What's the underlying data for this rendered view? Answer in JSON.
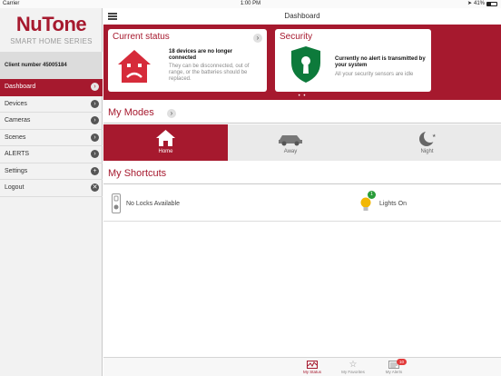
{
  "status_bar": {
    "carrier": "Carrier",
    "time": "1:00 PM",
    "battery": "41%"
  },
  "sidebar": {
    "brand": "NuTone",
    "series": "SMART HOME SERIES",
    "client": "Client number 45005184",
    "items": [
      {
        "label": "Dashboard",
        "btn": "›",
        "active": true
      },
      {
        "label": "Devices",
        "btn": "›"
      },
      {
        "label": "Cameras",
        "btn": "›"
      },
      {
        "label": "Scenes",
        "btn": "›"
      },
      {
        "label": "ALERTS",
        "btn": "›"
      },
      {
        "label": "Settings",
        "btn": "+"
      },
      {
        "label": "Logout",
        "btn": "✕"
      }
    ]
  },
  "header": {
    "title": "Dashboard"
  },
  "status_card": {
    "title": "Current status",
    "headline": "18  devices are no longer connected",
    "detail": "They can be disconnected, out of range, or the batteries should be replaced.",
    "arrow": "›"
  },
  "security_card": {
    "title": "Security",
    "headline": "Currently no alert is transmitted by your system",
    "detail": "All your security sensors are idle"
  },
  "pager": "• •",
  "modes": {
    "title": "My Modes",
    "arrow": "›",
    "items": [
      {
        "label": "Home",
        "icon": "house-icon"
      },
      {
        "label": "Away",
        "icon": "car-icon"
      },
      {
        "label": "Night",
        "icon": "moon-icon"
      }
    ]
  },
  "shortcuts": {
    "title": "My Shortcuts",
    "locks": "No Locks Available",
    "lights": "Lights On",
    "lights_count": "1"
  },
  "tabbar": {
    "items": [
      {
        "label": "My Status"
      },
      {
        "label": "My Favorites"
      },
      {
        "label": "My Alerts",
        "badge": "10"
      }
    ]
  },
  "colors": {
    "accent": "#a6192e",
    "security_green": "#0d7a3b",
    "badge_red": "#e23a3a"
  }
}
